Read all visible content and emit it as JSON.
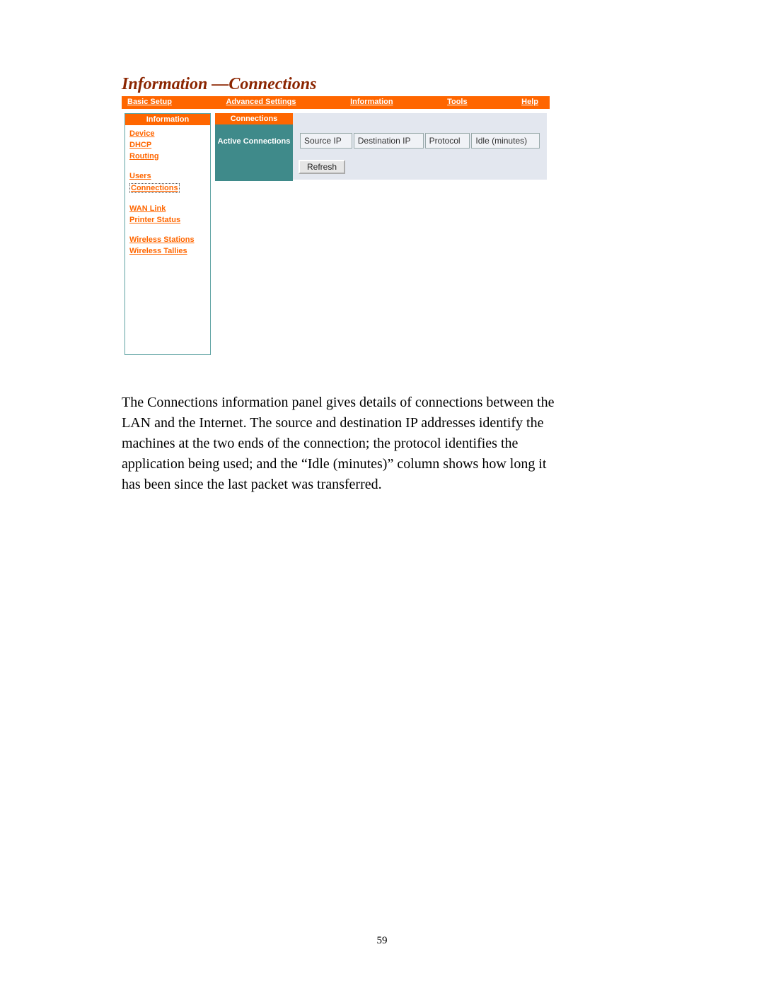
{
  "section_title": "Information  —Connections",
  "topnav": {
    "basic_setup": "Basic Setup",
    "advanced_settings": "Advanced Settings",
    "information": "Information",
    "tools": "Tools",
    "help": "Help"
  },
  "sidebar": {
    "header": "Information",
    "links": {
      "device": "Device",
      "dhcp": "DHCP",
      "routing": "Routing",
      "users": "Users",
      "connections": "Connections",
      "wan_link": "WAN Link",
      "printer_status": "Printer Status",
      "wireless_stations": "Wireless Stations",
      "wireless_tallies": "Wireless Tallies"
    }
  },
  "centercol": {
    "header": "Connections",
    "subheader": "Active Connections"
  },
  "table": {
    "headers": {
      "source_ip": "Source IP",
      "destination_ip": "Destination IP",
      "protocol": "Protocol",
      "idle": "Idle (minutes)"
    }
  },
  "refresh_label": "Refresh",
  "body_text": "The Connections information panel gives details of connections between the LAN and the Internet. The source and destination IP addresses identify the machines at the two ends of the connection; the protocol identifies the application being used; and the “Idle (minutes)” column shows how long it has been since the last packet was transferred.",
  "page_number": "59"
}
